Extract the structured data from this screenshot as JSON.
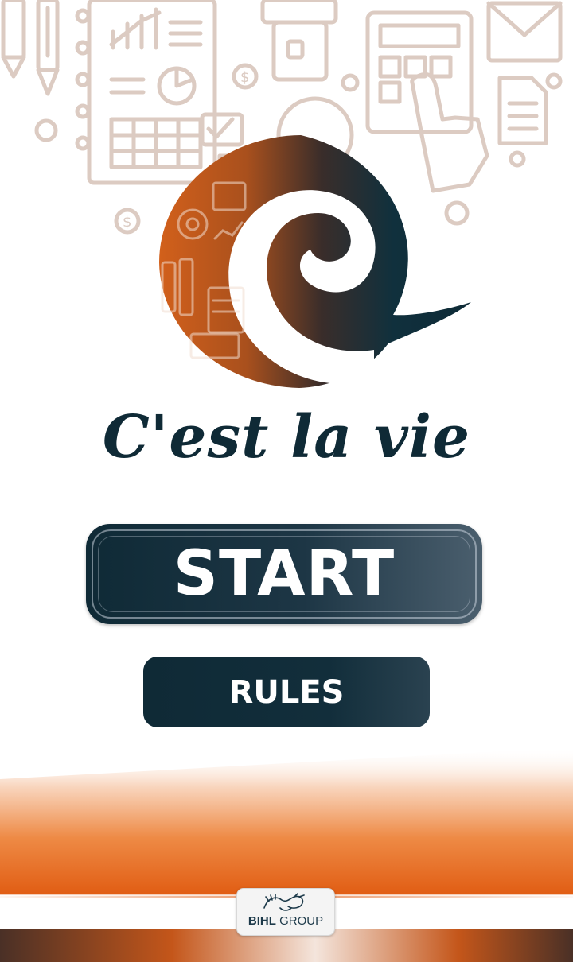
{
  "brand": {
    "app_title": "C'est la vie",
    "logo_icon": "spiral-swirl-logo"
  },
  "menu": {
    "start_label": "START",
    "rules_label": "RULES"
  },
  "footer": {
    "company_prefix": "BIHL",
    "company_suffix": "GROUP",
    "company_icon": "dragon-emblem-icon"
  },
  "background": {
    "icons": [
      "pencil-icon",
      "pen-icon",
      "clipboard-chart-icon",
      "pie-chart-icon",
      "calculator-icon",
      "envelope-icon",
      "document-icon",
      "coin-icon",
      "hand-pointer-icon",
      "gear-icon",
      "folder-icon"
    ]
  },
  "colors": {
    "navy": "#0f2a36",
    "orange": "#e05a10",
    "copper": "#c4561a",
    "sketch_lines": "#d8c6bd",
    "slate": "#4b5f6e"
  }
}
